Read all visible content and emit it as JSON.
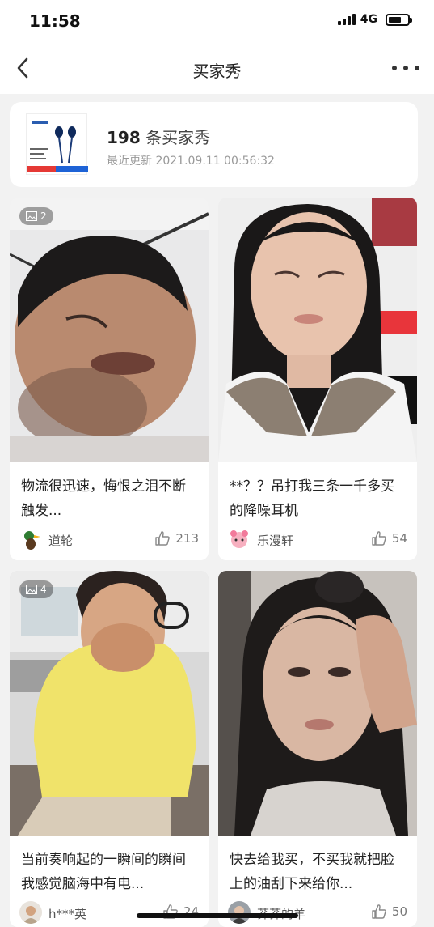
{
  "status_bar": {
    "time": "11:58",
    "network": "4G",
    "battery_level": 0.7
  },
  "nav": {
    "title": "买家秀"
  },
  "summary": {
    "count": "198",
    "count_suffix": "条买家秀",
    "updated": "最近更新 2021.09.11 00:56:32"
  },
  "posts": [
    {
      "image_count": "2",
      "text": "物流很迅速，悔恨之泪不断触发...",
      "user": "道轮",
      "likes": "213"
    },
    {
      "text": "**？？吊打我三条一千多买的降噪耳机",
      "user": "乐漫轩",
      "likes": "54"
    },
    {
      "image_count": "4",
      "text": "当前奏响起的一瞬间的瞬间我感觉脑海中有电...",
      "user": "h***英",
      "likes": "24"
    },
    {
      "text": "快去给我买，不买我就把脸上的油刮下来给你...",
      "user": "莽莽的羊",
      "likes": "50"
    }
  ]
}
